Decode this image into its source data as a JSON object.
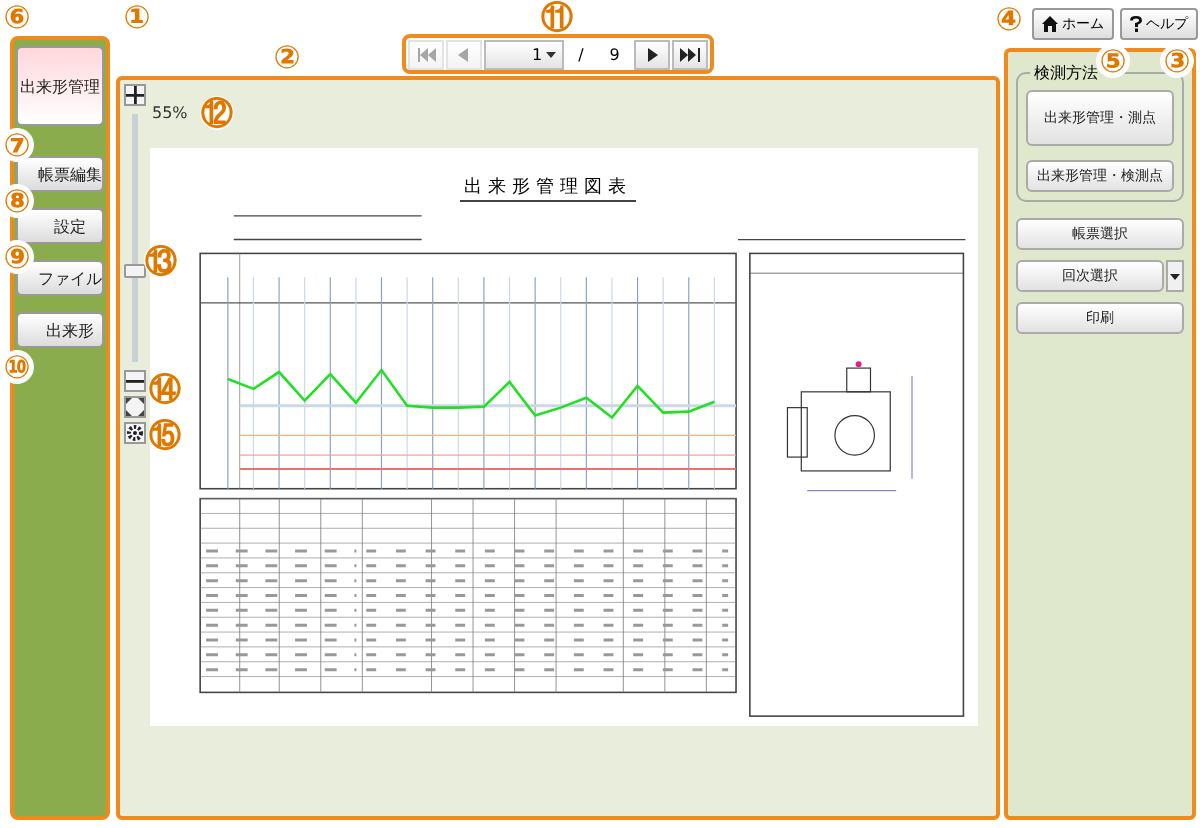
{
  "side_menu": [
    {
      "label": "出来形管理",
      "selected": true
    },
    {
      "label": "帳票編集",
      "selected": false
    },
    {
      "label": "設定",
      "selected": false
    },
    {
      "label": "ファイル",
      "selected": false
    },
    {
      "label": "出来形",
      "selected": false
    }
  ],
  "pager": {
    "buttons": [
      {
        "kind": "first",
        "disabled": true
      },
      {
        "kind": "prev",
        "disabled": true
      },
      {
        "kind": "next",
        "disabled": false
      },
      {
        "kind": "last",
        "disabled": false
      }
    ],
    "current": "1",
    "separator": "/",
    "total": "9"
  },
  "zoom": {
    "percent": "55%",
    "level": 0.37
  },
  "document": {
    "title": "出来形管理図表"
  },
  "header_buttons": [
    {
      "label": "ホーム",
      "kind": "home"
    },
    {
      "label": "ヘルプ",
      "kind": "help"
    }
  ],
  "measure_group": {
    "title": "検測方法",
    "buttons": [
      "出来形管理・測点",
      "出来形管理・検測点"
    ]
  },
  "actions": [
    {
      "label": "帳票選択",
      "kind": "button"
    },
    {
      "label": "回次選択",
      "kind": "dropdown"
    },
    {
      "label": "印刷",
      "kind": "button"
    }
  ],
  "callouts": [
    {
      "label": "⑥"
    },
    {
      "label": "①"
    },
    {
      "label": "⑪"
    },
    {
      "label": "④"
    },
    {
      "label": "②"
    },
    {
      "label": "⑤"
    },
    {
      "label": "③"
    },
    {
      "label": "⑫"
    },
    {
      "label": "⑦"
    },
    {
      "label": "⑧"
    },
    {
      "label": "⑨"
    },
    {
      "label": "⑬"
    },
    {
      "label": "⑩"
    },
    {
      "label": "⑭"
    },
    {
      "label": "⑮"
    }
  ]
}
